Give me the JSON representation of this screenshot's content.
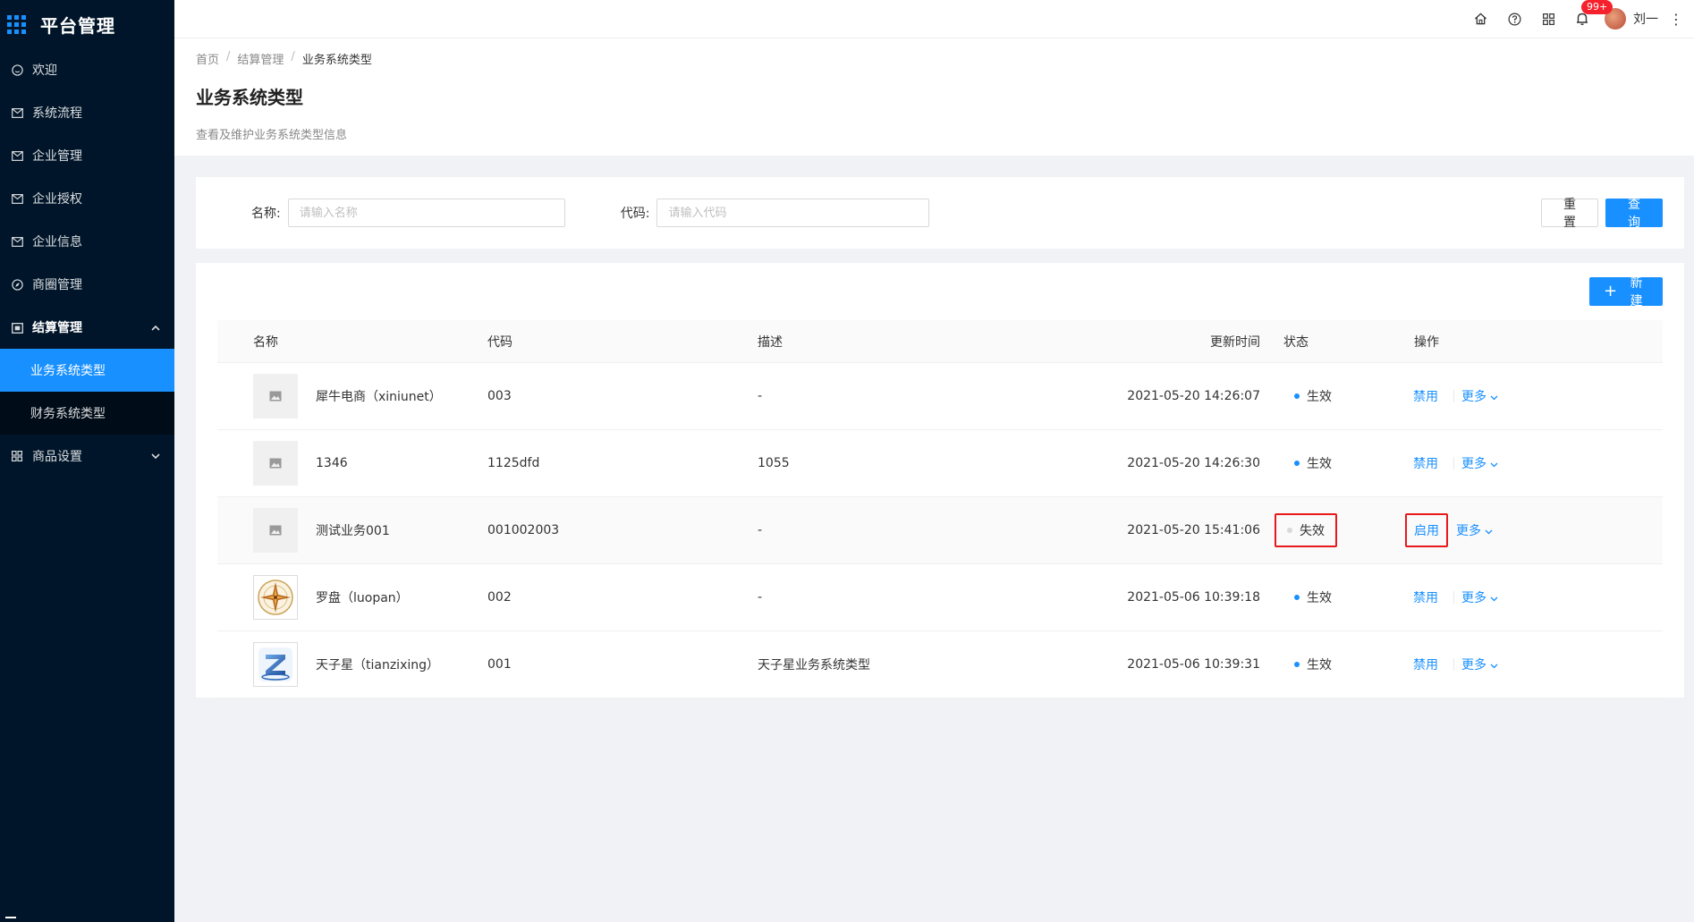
{
  "app": {
    "title": "平台管理"
  },
  "sidebar": {
    "items": [
      {
        "label": "欢迎",
        "icon": "smile-icon"
      },
      {
        "label": "系统流程",
        "icon": "mail-icon"
      },
      {
        "label": "企业管理",
        "icon": "mail-icon"
      },
      {
        "label": "企业授权",
        "icon": "mail-icon"
      },
      {
        "label": "企业信息",
        "icon": "mail-icon"
      },
      {
        "label": "商圈管理",
        "icon": "compass-icon"
      }
    ],
    "open_group": {
      "label": "结算管理",
      "icon": "calendar-icon",
      "children": [
        {
          "label": "业务系统类型",
          "active": true
        },
        {
          "label": "财务系统类型",
          "active": false
        }
      ]
    },
    "collapsed_group": {
      "label": "商品设置",
      "icon": "appstore-icon"
    }
  },
  "header": {
    "notification_badge": "99+",
    "user_name": "刘一"
  },
  "page": {
    "breadcrumb": [
      "首页",
      "结算管理",
      "业务系统类型"
    ],
    "title": "业务系统类型",
    "description": "查看及维护业务系统类型信息"
  },
  "search": {
    "name_label": "名称:",
    "name_placeholder": "请输入名称",
    "code_label": "代码:",
    "code_placeholder": "请输入代码",
    "reset_label": "重 置",
    "query_label": "查 询"
  },
  "table": {
    "new_button": "新建",
    "columns": [
      "名称",
      "代码",
      "描述",
      "更新时间",
      "状态",
      "操作"
    ],
    "rows": [
      {
        "name": "犀牛电商（xiniunet）",
        "code": "003",
        "desc": "-",
        "updated": "2021-05-20 14:26:07",
        "status": "生效",
        "action": "禁用",
        "more": "更多",
        "thumb": "image-placeholder-icon"
      },
      {
        "name": "1346",
        "code": "1125dfd",
        "desc": "1055",
        "updated": "2021-05-20 14:26:30",
        "status": "生效",
        "action": "禁用",
        "more": "更多",
        "thumb": "image-placeholder-icon"
      },
      {
        "name": "测试业务001",
        "code": "001002003",
        "desc": "-",
        "updated": "2021-05-20 15:41:06",
        "status": "失效",
        "action": "启用",
        "more": "更多",
        "thumb": "image-placeholder-icon"
      },
      {
        "name": "罗盘（luopan）",
        "code": "002",
        "desc": "-",
        "updated": "2021-05-06 10:39:18",
        "status": "生效",
        "action": "禁用",
        "more": "更多",
        "thumb": "compass-logo"
      },
      {
        "name": "天子星（tianzixing）",
        "code": "001",
        "desc": "天子星业务系统类型",
        "updated": "2021-05-06 10:39:31",
        "status": "生效",
        "action": "禁用",
        "more": "更多",
        "thumb": "z-logo"
      }
    ]
  },
  "colors": {
    "primary": "#1890ff",
    "sidebar_bg": "#001529",
    "highlight": "#e8191a"
  }
}
